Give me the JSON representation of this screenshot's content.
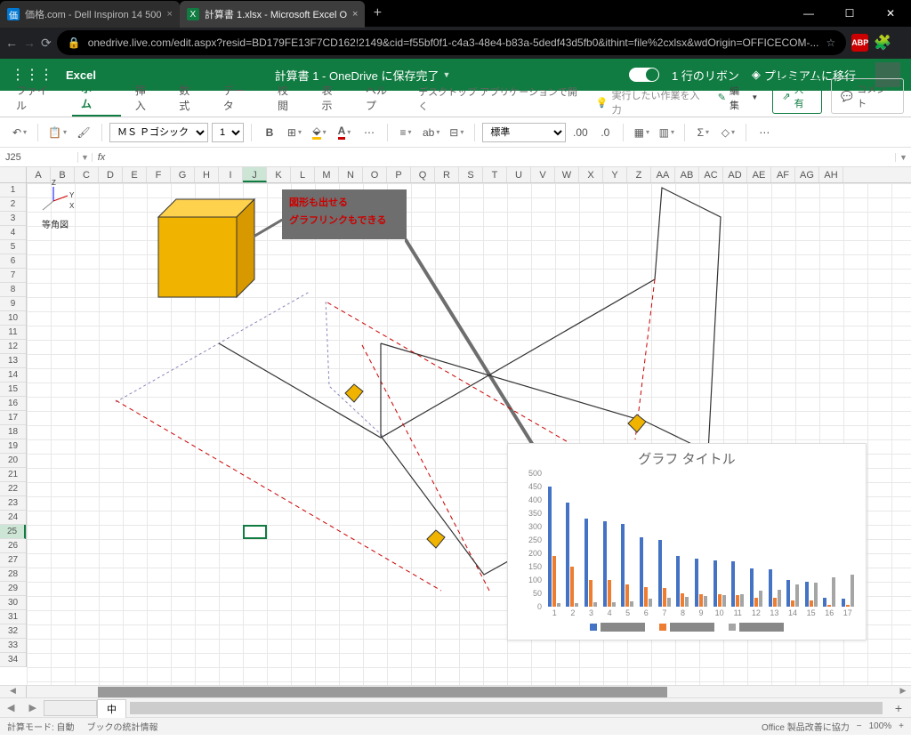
{
  "browser": {
    "tabs": [
      {
        "icon": "K",
        "label": "価格.com - Dell Inspiron 14 500"
      },
      {
        "icon": "X",
        "label": "計算書 1.xlsx - Microsoft Excel O"
      }
    ],
    "url": "onedrive.live.com/edit.aspx?resid=BD179FE13F7CD162!2149&cid=f55bf0f1-c4a3-48e4-b83a-5dedf43d5fb0&ithint=file%2cxlsx&wdOrigin=OFFICECOM-..."
  },
  "header": {
    "brand": "Excel",
    "doc_title": "計算書 1 - OneDrive に保存完了",
    "ribbon_toggle": "1 行のリボン",
    "premium": "プレミアムに移行"
  },
  "ribbon_tabs": [
    "ファイル",
    "ホーム",
    "挿入",
    "数式",
    "データ",
    "校閲",
    "表示",
    "ヘルプ"
  ],
  "ribbon_right": {
    "desktop": "デスクトップ アプリケーションで開く",
    "search_ph": "実行したい作業を入力",
    "edit": "編集",
    "share": "共有",
    "comment": "コメント"
  },
  "toolbar": {
    "font": "ＭＳ Ｐゴシック",
    "font_size": "11",
    "number_format": "標準"
  },
  "name_box": "J25",
  "axis_label": "等角図",
  "callout": {
    "l1": "図形も出せる",
    "l2": "グラフリンクもできる"
  },
  "chart_data": {
    "type": "bar",
    "title": "グラフ タイトル",
    "categories": [
      "1",
      "2",
      "3",
      "4",
      "5",
      "6",
      "7",
      "8",
      "9",
      "10",
      "11",
      "12",
      "13",
      "14",
      "15",
      "16",
      "17"
    ],
    "ylim": [
      0,
      500
    ],
    "yticks": [
      0,
      50,
      100,
      150,
      200,
      250,
      300,
      350,
      400,
      450,
      500
    ],
    "series": [
      {
        "name": "s1",
        "color": "#4472c4",
        "values": [
          450,
          390,
          330,
          320,
          310,
          260,
          250,
          190,
          180,
          175,
          170,
          145,
          140,
          100,
          95,
          35,
          30
        ]
      },
      {
        "name": "s2",
        "color": "#ed7d31",
        "values": [
          190,
          150,
          100,
          100,
          85,
          75,
          70,
          50,
          48,
          46,
          44,
          34,
          32,
          25,
          22,
          8,
          6
        ]
      },
      {
        "name": "s3",
        "color": "#a5a5a5",
        "values": [
          12,
          14,
          16,
          18,
          20,
          30,
          32,
          38,
          40,
          45,
          48,
          60,
          62,
          85,
          90,
          110,
          120
        ]
      }
    ]
  },
  "sheet_tabs": {
    "active": "中"
  },
  "status": {
    "calc": "計算モード: 自動",
    "stats": "ブックの統計情報",
    "improve": "Office 製品改善に協力",
    "zoom": "100%"
  },
  "cols": [
    "A",
    "B",
    "C",
    "D",
    "E",
    "F",
    "G",
    "H",
    "I",
    "J",
    "K",
    "L",
    "M",
    "N",
    "O",
    "P",
    "Q",
    "R",
    "S",
    "T",
    "U",
    "V",
    "W",
    "X",
    "Y",
    "Z",
    "AA",
    "AB",
    "AC",
    "AD",
    "AE",
    "AF",
    "AG",
    "AH"
  ]
}
